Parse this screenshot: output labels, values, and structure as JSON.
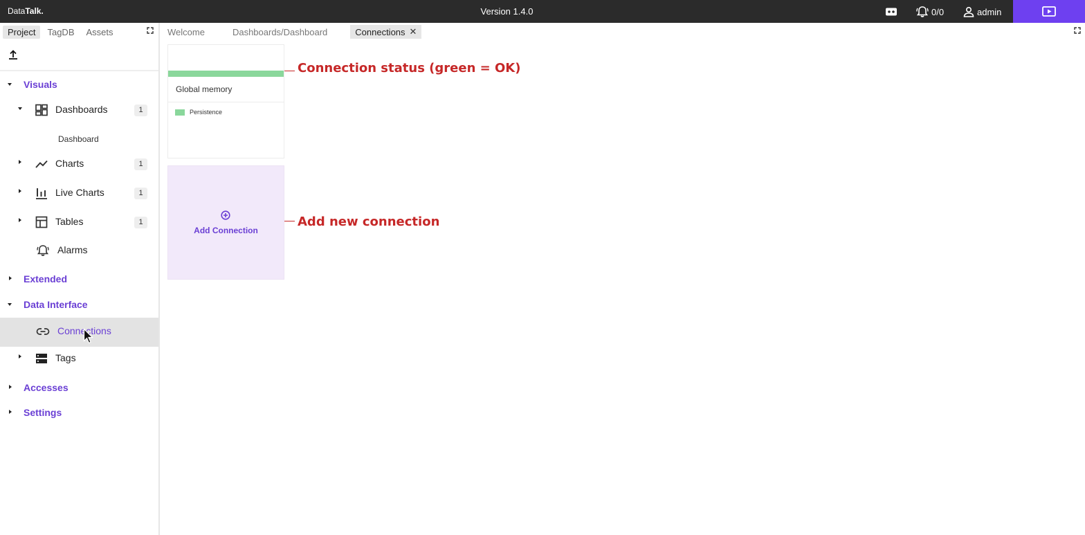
{
  "topbar": {
    "brand_regular": "Data",
    "brand_bold": "Talk.",
    "version": "Version 1.4.0",
    "alarm_count": "0/0",
    "user": "admin"
  },
  "sidebar": {
    "tabs": [
      "Project",
      "TagDB",
      "Assets"
    ],
    "sections": {
      "visuals": "Visuals",
      "extended": "Extended",
      "data_interface": "Data Interface",
      "accesses": "Accesses",
      "settings": "Settings"
    },
    "items": {
      "dashboards": {
        "label": "Dashboards",
        "count": "1"
      },
      "dashboard_sub": "Dashboard",
      "charts": {
        "label": "Charts",
        "count": "1"
      },
      "live_charts": {
        "label": "Live Charts",
        "count": "1"
      },
      "tables": {
        "label": "Tables",
        "count": "1"
      },
      "alarms": {
        "label": "Alarms"
      },
      "connections": {
        "label": "Connections"
      },
      "tags": {
        "label": "Tags"
      }
    }
  },
  "main": {
    "tabs": [
      "Welcome",
      "Dashboards/Dashboard",
      "Connections"
    ],
    "connection_card": {
      "name": "Global memory",
      "legend": "Persistence",
      "status_color": "#8ad79b"
    },
    "add_card": {
      "label": "Add Connection"
    }
  },
  "annotations": {
    "status": "Connection status (green = OK)",
    "add": "Add new connection"
  },
  "colors": {
    "accent": "#6a3fd4",
    "topbar": "#2b2b2b",
    "present_button": "#6e40f0",
    "status_ok": "#8ad79b",
    "annotation": "#c62828"
  }
}
